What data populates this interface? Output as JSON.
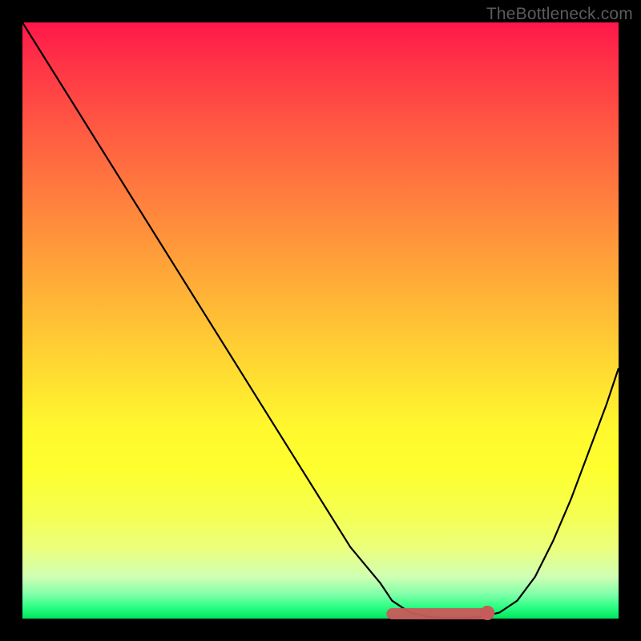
{
  "watermark": "TheBottleneck.com",
  "chart_data": {
    "type": "line",
    "title": "",
    "xlabel": "",
    "ylabel": "",
    "xlim": [
      0,
      100
    ],
    "ylim": [
      0,
      100
    ],
    "grid": false,
    "legend": false,
    "series": [
      {
        "name": "bottleneck-curve",
        "x": [
          0,
          5,
          10,
          15,
          20,
          25,
          30,
          35,
          40,
          45,
          50,
          55,
          60,
          62,
          65,
          68,
          71,
          74,
          77,
          80,
          83,
          86,
          89,
          92,
          95,
          98,
          100
        ],
        "y": [
          100,
          92,
          84,
          76,
          68,
          60,
          52,
          44,
          36,
          28,
          20,
          12,
          6,
          3,
          1,
          0.3,
          0.1,
          0.1,
          0.3,
          1,
          3,
          7,
          13,
          20,
          28,
          36,
          42
        ]
      }
    ],
    "optimal_band": {
      "x_start": 62,
      "x_end": 78,
      "y": 0
    },
    "marker_dot": {
      "x": 78,
      "y": 0
    },
    "background": {
      "type": "vertical-gradient",
      "stops": [
        {
          "pos": 0.0,
          "color": "#ff174a"
        },
        {
          "pos": 0.5,
          "color": "#ffcf34"
        },
        {
          "pos": 0.75,
          "color": "#feff2f"
        },
        {
          "pos": 1.0,
          "color": "#00e65e"
        }
      ]
    }
  }
}
